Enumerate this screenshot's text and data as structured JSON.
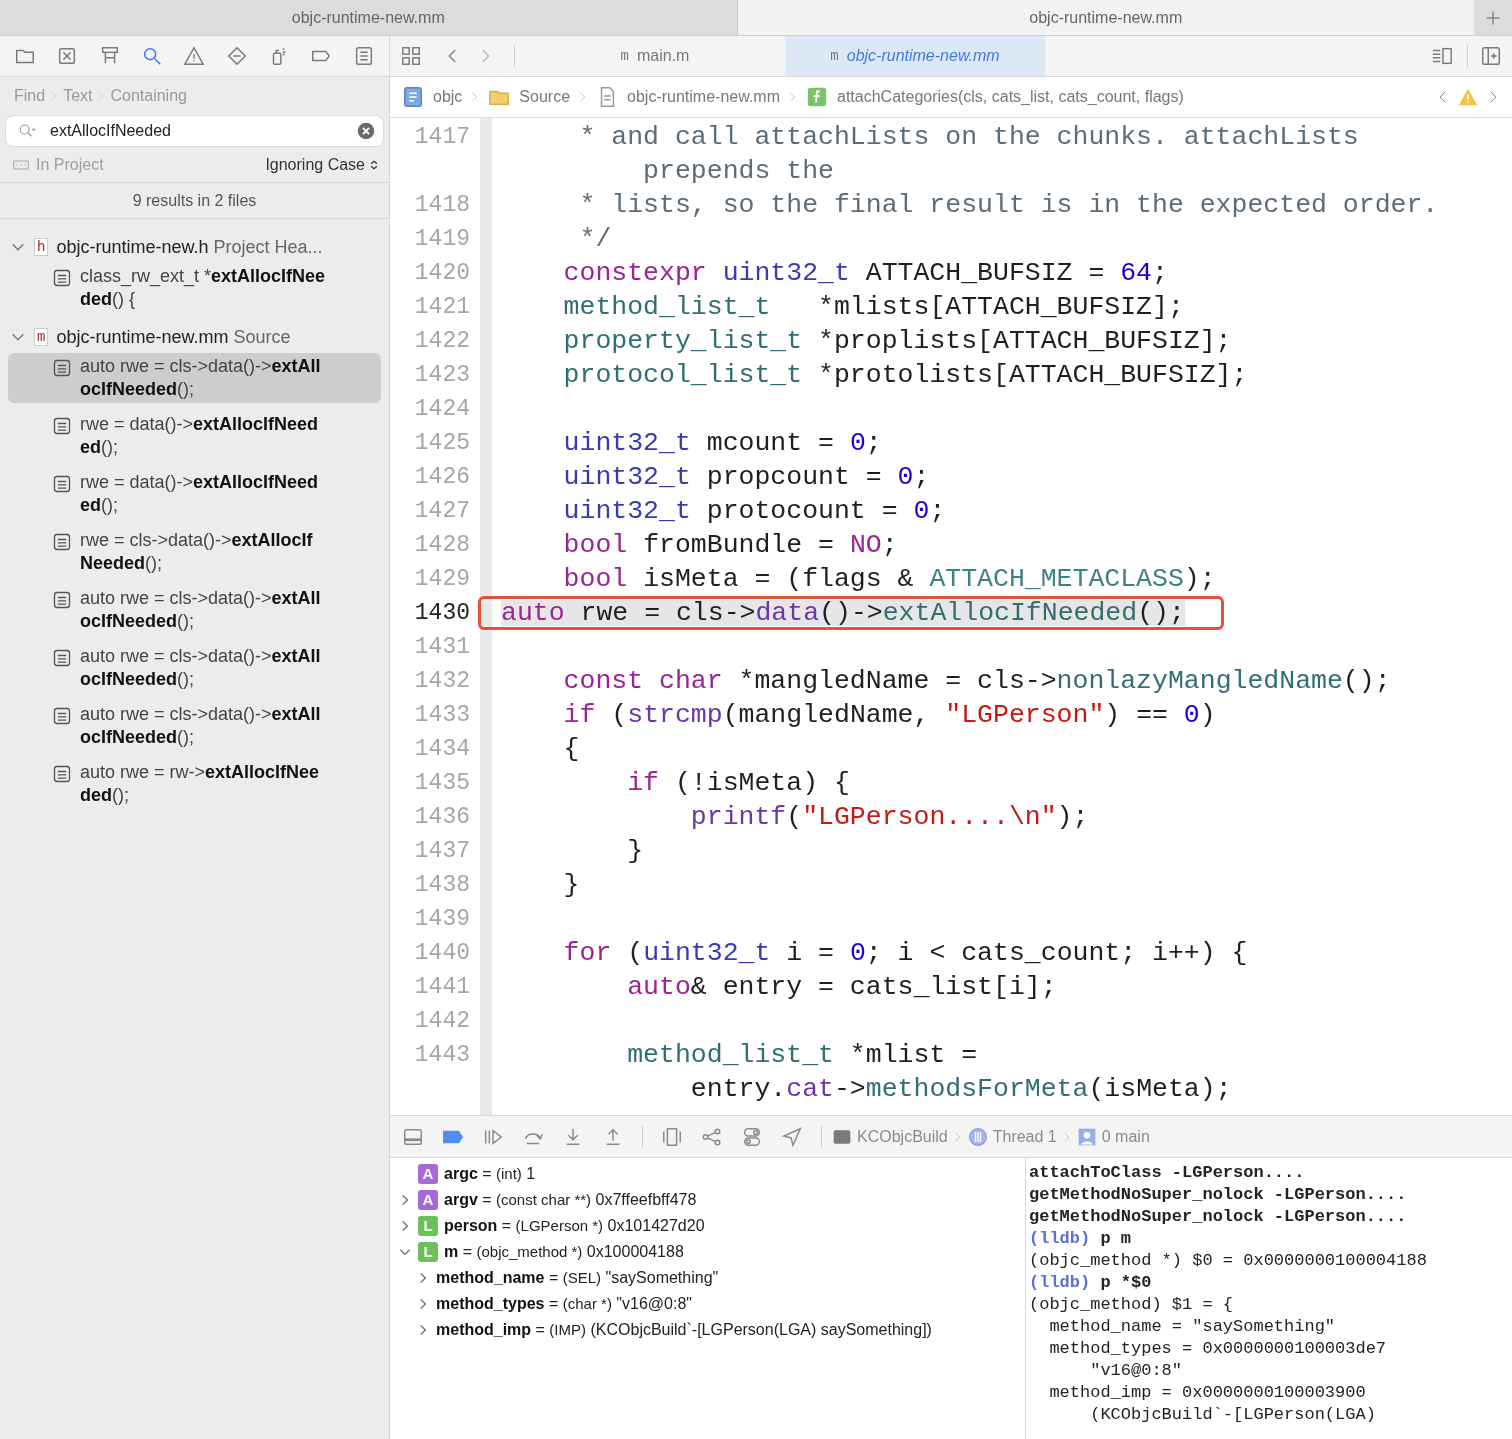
{
  "window_tabs": [
    {
      "label": "objc-runtime-new.mm",
      "selected": false
    },
    {
      "label": "objc-runtime-new.mm",
      "selected": true
    }
  ],
  "navigator_icons": [
    {
      "kind": "folder",
      "selected": false
    },
    {
      "kind": "xbox",
      "selected": false
    },
    {
      "kind": "hierarchy",
      "selected": false
    },
    {
      "kind": "search",
      "selected": true
    },
    {
      "kind": "warning",
      "selected": false
    },
    {
      "kind": "diamond",
      "selected": false
    },
    {
      "kind": "spray",
      "selected": false
    },
    {
      "kind": "tag",
      "selected": false
    },
    {
      "kind": "list",
      "selected": false
    }
  ],
  "editor_tabs": [
    {
      "icon": "m",
      "label": "main.m",
      "selected": false
    },
    {
      "icon": "m",
      "label": "objc-runtime-new.mm",
      "selected": true
    }
  ],
  "find": {
    "path": [
      "Find",
      "Text",
      "Containing"
    ],
    "query": "extAllocIfNeeded",
    "scope": "In Project",
    "matching": "Ignoring Case",
    "summary": "9 results in 2 files"
  },
  "results": [
    {
      "icon": "h",
      "name": "objc-runtime-new.h",
      "group": "Project Hea...",
      "expanded": true,
      "children": [
        {
          "before": "class_rw_ext_t *",
          "match": "extAllocIfNee",
          "match2": "ded",
          "after": "() {",
          "selected": false
        }
      ]
    },
    {
      "icon": "m",
      "name": "objc-runtime-new.mm",
      "group": "Source",
      "expanded": true,
      "children": [
        {
          "before": "auto rwe = cls->data()->",
          "match": "extAll",
          "match2": "ocIfNeeded",
          "after": "();",
          "selected": true
        },
        {
          "before": "rwe = data()->",
          "match": "extAllocIfNeed",
          "match2": "ed",
          "after": "();",
          "selected": false
        },
        {
          "before": "rwe = data()->",
          "match": "extAllocIfNeed",
          "match2": "ed",
          "after": "();",
          "selected": false
        },
        {
          "before": "rwe = cls->data()->",
          "match": "extAllocIf",
          "match2": "Needed",
          "after": "();",
          "selected": false
        },
        {
          "before": "auto rwe = cls->data()->",
          "match": "extAll",
          "match2": "ocIfNeeded",
          "after": "();",
          "selected": false
        },
        {
          "before": "auto rwe = cls->data()->",
          "match": "extAll",
          "match2": "ocIfNeeded",
          "after": "();",
          "selected": false
        },
        {
          "before": "auto rwe = cls->data()->",
          "match": "extAll",
          "match2": "ocIfNeeded",
          "after": "();",
          "selected": false
        },
        {
          "before": "auto rwe = rw->",
          "match": "extAllocIfNee",
          "match2": "ded",
          "after": "();",
          "selected": false
        }
      ]
    }
  ],
  "breadcrumb": [
    {
      "kind": "project",
      "label": "objc"
    },
    {
      "kind": "folder",
      "label": "Source"
    },
    {
      "kind": "file",
      "label": "objc-runtime-new.mm"
    },
    {
      "kind": "function",
      "label": "attachCategories(cls, cats_list, cats_count, flags)"
    }
  ],
  "code_lines": [
    {
      "number": "1417",
      "current": false,
      "annotated": false,
      "segments": [
        {
          "kind": "comment",
          "t": "     * and call attachLists on the chunks. attachLists"
        }
      ],
      "continuation": [
        {
          "kind": "comment",
          "t": "         prepends the"
        }
      ]
    },
    {
      "number": "1418",
      "current": false,
      "annotated": false,
      "segments": [
        {
          "kind": "comment",
          "t": "     * lists, so the final result is in the expected order."
        }
      ]
    },
    {
      "number": "1419",
      "current": false,
      "annotated": false,
      "segments": [
        {
          "kind": "comment",
          "t": "     */"
        }
      ]
    },
    {
      "number": "1420",
      "current": false,
      "annotated": false,
      "segments": [
        {
          "kind": "keyword",
          "t": "    constexpr"
        },
        {
          "kind": "type",
          "t": " uint32_t"
        },
        {
          "kind": "plain",
          "t": " ATTACH_BUFSIZ = "
        },
        {
          "kind": "number",
          "t": "64"
        },
        {
          "kind": "plain",
          "t": ";"
        }
      ]
    },
    {
      "number": "1421",
      "current": false,
      "annotated": false,
      "segments": [
        {
          "kind": "class",
          "t": "    method_list_t"
        },
        {
          "kind": "plain",
          "t": "   *mlists[ATTACH_BUFSIZ];"
        }
      ]
    },
    {
      "number": "1422",
      "current": false,
      "annotated": false,
      "segments": [
        {
          "kind": "class",
          "t": "    property_list_t"
        },
        {
          "kind": "plain",
          "t": " *proplists[ATTACH_BUFSIZ];"
        }
      ]
    },
    {
      "number": "1423",
      "current": false,
      "annotated": false,
      "segments": [
        {
          "kind": "class",
          "t": "    protocol_list_t"
        },
        {
          "kind": "plain",
          "t": " *protolists[ATTACH_BUFSIZ];"
        }
      ]
    },
    {
      "number": "1424",
      "current": false,
      "annotated": false
    },
    {
      "number": "1425",
      "current": false,
      "annotated": false,
      "segments": [
        {
          "kind": "type",
          "t": "    uint32_t"
        },
        {
          "kind": "plain",
          "t": " mcount = "
        },
        {
          "kind": "number",
          "t": "0"
        },
        {
          "kind": "plain",
          "t": ";"
        }
      ]
    },
    {
      "number": "1426",
      "current": false,
      "annotated": false,
      "segments": [
        {
          "kind": "type",
          "t": "    uint32_t"
        },
        {
          "kind": "plain",
          "t": " propcount = "
        },
        {
          "kind": "number",
          "t": "0"
        },
        {
          "kind": "plain",
          "t": ";"
        }
      ]
    },
    {
      "number": "1427",
      "current": false,
      "annotated": false,
      "segments": [
        {
          "kind": "type",
          "t": "    uint32_t"
        },
        {
          "kind": "plain",
          "t": " protocount = "
        },
        {
          "kind": "number",
          "t": "0"
        },
        {
          "kind": "plain",
          "t": ";"
        }
      ]
    },
    {
      "number": "1428",
      "current": false,
      "annotated": false,
      "segments": [
        {
          "kind": "keyword",
          "t": "    bool"
        },
        {
          "kind": "plain",
          "t": " fromBundle = "
        },
        {
          "kind": "keyword",
          "t": "NO"
        },
        {
          "kind": "plain",
          "t": ";"
        }
      ]
    },
    {
      "number": "1429",
      "current": false,
      "annotated": false,
      "segments": [
        {
          "kind": "keyword",
          "t": "    bool"
        },
        {
          "kind": "plain",
          "t": " isMeta = (flags & "
        },
        {
          "kind": "macro",
          "t": "ATTACH_METACLASS"
        },
        {
          "kind": "plain",
          "t": ");"
        }
      ]
    },
    {
      "number": "1430",
      "current": true,
      "annotated": true,
      "segments": [
        {
          "kind": "keyword",
          "t": "auto"
        },
        {
          "kind": "plain",
          "t": " rwe = cls->"
        },
        {
          "kind": "func",
          "t": "data"
        },
        {
          "kind": "plain",
          "t": "()->"
        },
        {
          "kind": "method",
          "t": "extAllocIfNeeded"
        },
        {
          "kind": "plain",
          "t": "();"
        }
      ]
    },
    {
      "number": "1431",
      "current": false,
      "annotated": false
    },
    {
      "number": "1432",
      "current": false,
      "annotated": false,
      "segments": [
        {
          "kind": "keyword",
          "t": "    const"
        },
        {
          "kind": "keyword",
          "t": " char"
        },
        {
          "kind": "plain",
          "t": " *mangledName = cls->"
        },
        {
          "kind": "method",
          "t": "nonlazyMangledName"
        },
        {
          "kind": "plain",
          "t": "();"
        }
      ]
    },
    {
      "number": "1433",
      "current": false,
      "annotated": false,
      "segments": [
        {
          "kind": "keyword",
          "t": "    if"
        },
        {
          "kind": "plain",
          "t": " ("
        },
        {
          "kind": "func",
          "t": "strcmp"
        },
        {
          "kind": "plain",
          "t": "(mangledName, "
        },
        {
          "kind": "string",
          "t": "\"LGPerson\""
        },
        {
          "kind": "plain",
          "t": ") == "
        },
        {
          "kind": "number",
          "t": "0"
        },
        {
          "kind": "plain",
          "t": ")"
        }
      ]
    },
    {
      "number": "1434",
      "current": false,
      "annotated": false,
      "segments": [
        {
          "kind": "plain",
          "t": "    {"
        }
      ]
    },
    {
      "number": "1435",
      "current": false,
      "annotated": false,
      "segments": [
        {
          "kind": "keyword",
          "t": "        if"
        },
        {
          "kind": "plain",
          "t": " (!isMeta) {"
        }
      ]
    },
    {
      "number": "1436",
      "current": false,
      "annotated": false,
      "segments": [
        {
          "kind": "func",
          "t": "            printf"
        },
        {
          "kind": "plain",
          "t": "("
        },
        {
          "kind": "string",
          "t": "\"LGPerson....\\n\""
        },
        {
          "kind": "plain",
          "t": ");"
        }
      ]
    },
    {
      "number": "1437",
      "current": false,
      "annotated": false,
      "segments": [
        {
          "kind": "plain",
          "t": "        }"
        }
      ]
    },
    {
      "number": "1438",
      "current": false,
      "annotated": false,
      "segments": [
        {
          "kind": "plain",
          "t": "    }"
        }
      ]
    },
    {
      "number": "1439",
      "current": false,
      "annotated": false
    },
    {
      "number": "1440",
      "current": false,
      "annotated": false,
      "segments": [
        {
          "kind": "keyword",
          "t": "    for"
        },
        {
          "kind": "plain",
          "t": " ("
        },
        {
          "kind": "type",
          "t": "uint32_t"
        },
        {
          "kind": "plain",
          "t": " i = "
        },
        {
          "kind": "number",
          "t": "0"
        },
        {
          "kind": "plain",
          "t": "; i < cats_count; i++) {"
        }
      ]
    },
    {
      "number": "1441",
      "current": false,
      "annotated": false,
      "segments": [
        {
          "kind": "keyword",
          "t": "        auto"
        },
        {
          "kind": "plain",
          "t": "& entry = cats_list[i];"
        }
      ]
    },
    {
      "number": "1442",
      "current": false,
      "annotated": false
    },
    {
      "number": "1443",
      "current": false,
      "annotated": false,
      "segments": [
        {
          "kind": "class",
          "t": "        method_list_t"
        },
        {
          "kind": "plain",
          "t": " *mlist ="
        }
      ],
      "continuation": [
        {
          "kind": "plain",
          "t": "            entry."
        },
        {
          "kind": "func",
          "t": "cat"
        },
        {
          "kind": "plain",
          "t": "->"
        },
        {
          "kind": "method",
          "t": "methodsForMeta"
        },
        {
          "kind": "plain",
          "t": "(isMeta);"
        }
      ]
    }
  ],
  "debug_bar": {
    "icons": [
      {
        "kind": "panel"
      },
      {
        "kind": "breakpoint"
      },
      {
        "kind": "continue"
      },
      {
        "kind": "step-over"
      },
      {
        "kind": "step-into"
      },
      {
        "kind": "step-out"
      },
      {
        "kind": "view-debugger"
      },
      {
        "kind": "memory-graph"
      },
      {
        "kind": "environment"
      },
      {
        "kind": "location"
      }
    ],
    "breakpoints_active": true,
    "path": [
      {
        "kind": "app",
        "label": "KCObjcBuild"
      },
      {
        "kind": "thread",
        "label": "Thread 1"
      },
      {
        "kind": "frame",
        "label": "0 main"
      }
    ]
  },
  "variables": [
    {
      "badge": "A",
      "name": "argc",
      "op": "=",
      "type": "(int)",
      "value": "1"
    },
    {
      "badge": "A",
      "name": "argv",
      "op": "=",
      "type": "(const char **)",
      "value": "0x7ffeefbff478",
      "expanded": false
    },
    {
      "badge": "L",
      "name": "person",
      "op": "=",
      "type": "(LGPerson *)",
      "value": "0x101427d20",
      "expanded": false
    },
    {
      "badge": "L",
      "name": "m",
      "op": "=",
      "type": "(objc_method *)",
      "value": "0x100004188",
      "expanded": true,
      "children": [
        {
          "name": "method_name",
          "op": "=",
          "type": "(SEL)",
          "value": "\"saySomething\"",
          "expanded": false
        },
        {
          "name": "method_types",
          "op": "=",
          "type": "(char *)",
          "value": "\"v16@0:8\"",
          "expanded": false
        },
        {
          "name": "method_imp",
          "op": "=",
          "type": "(IMP)",
          "value": "(KCObjcBuild`-[LGPerson(LGA) saySomething])",
          "expanded": false
        }
      ]
    }
  ],
  "console": [
    {
      "kind": "program",
      "text": "attachToClass -LGPerson...."
    },
    {
      "kind": "program",
      "text": "getMethodNoSuper_nolock -LGPerson...."
    },
    {
      "kind": "program",
      "text": "getMethodNoSuper_nolock -LGPerson...."
    },
    {
      "kind": "prompt",
      "prompt": "(lldb)",
      "text": "p m"
    },
    {
      "kind": "result",
      "text": "(objc_method *) $0 = 0x0000000100004188"
    },
    {
      "kind": "prompt",
      "prompt": "(lldb)",
      "text": "p *$0"
    },
    {
      "kind": "result",
      "text": "(objc_method) $1 = {"
    },
    {
      "kind": "result",
      "text": "  method_name = \"saySomething\""
    },
    {
      "kind": "result",
      "text": "  method_types = 0x0000000100003de7"
    },
    {
      "kind": "result",
      "text": "      \"v16@0:8\""
    },
    {
      "kind": "result",
      "text": "  method_imp = 0x0000000100003900"
    },
    {
      "kind": "result",
      "text": "      (KCObjcBuild`-[LGPerson(LGA)"
    }
  ]
}
